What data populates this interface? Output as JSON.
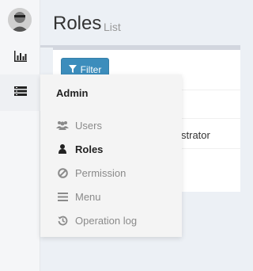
{
  "header": {
    "title": "Roles",
    "subtitle": "List"
  },
  "toolbar": {
    "filter_label": "Filter",
    "filter_icon": "filter-icon"
  },
  "table": {
    "visible_cell": "strator"
  },
  "sidebar": {
    "items": [
      {
        "icon": "avatar"
      },
      {
        "icon": "bar-chart-icon"
      },
      {
        "icon": "admin-menu-icon"
      }
    ]
  },
  "menu": {
    "heading": "Admin",
    "items": [
      {
        "label": "Users",
        "icon": "users-icon"
      },
      {
        "label": "Roles",
        "icon": "user-icon"
      },
      {
        "label": "Permission",
        "icon": "ban-icon"
      },
      {
        "label": "Menu",
        "icon": "bars-icon"
      },
      {
        "label": "Operation log",
        "icon": "history-icon"
      }
    ],
    "active_index": 1
  },
  "colors": {
    "primary": "#3c8dbc",
    "background": "#ecf0f5",
    "menu_bg": "#f4f4f4"
  }
}
